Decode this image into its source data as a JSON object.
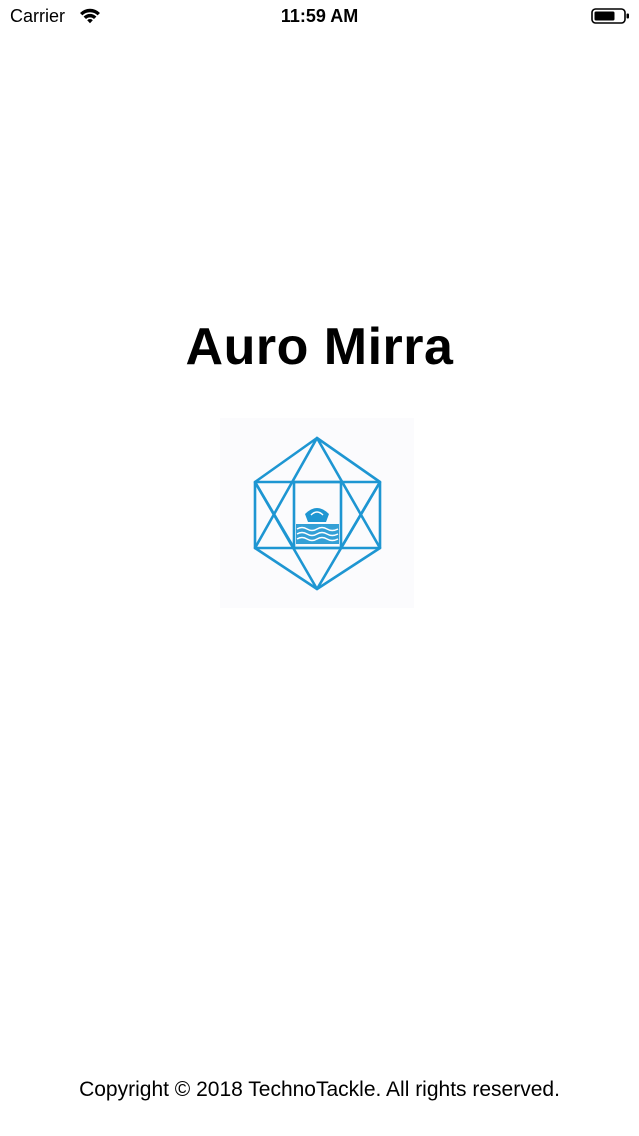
{
  "status_bar": {
    "carrier": "Carrier",
    "time": "11:59 AM",
    "wifi_icon": "wifi-icon",
    "battery_icon": "battery-icon"
  },
  "splash": {
    "title": "Auro Mirra",
    "logo_icon": "hexagon-logo-icon",
    "logo_color": "#1E96D2",
    "copyright": "Copyright © 2018 TechnoTackle. All rights reserved."
  }
}
